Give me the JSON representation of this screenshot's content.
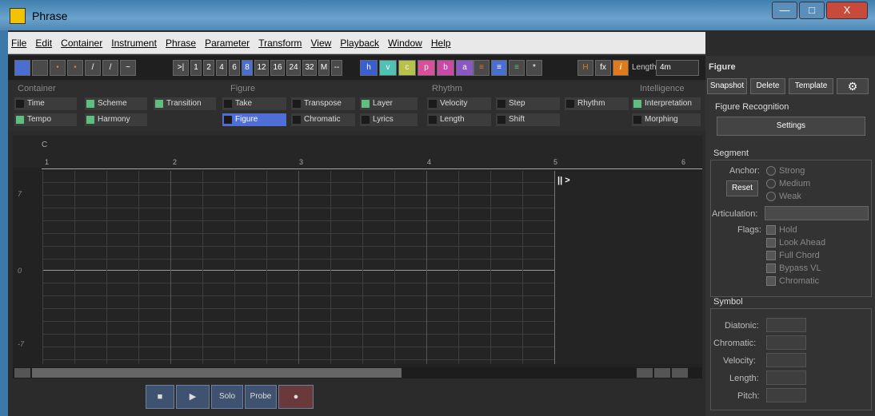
{
  "window": {
    "title": "Phrase"
  },
  "menu": [
    "File",
    "Edit",
    "Container",
    "Instrument",
    "Phrase",
    "Parameter",
    "Transform",
    "View",
    "Playback",
    "Window",
    "Help"
  ],
  "toolbar": {
    "jump": ">|",
    "resolutions": [
      "1",
      "2",
      "4",
      "6",
      "8",
      "12",
      "16",
      "24",
      "32",
      "M",
      "--"
    ],
    "letters": [
      "h",
      "v",
      "c",
      "p",
      "b",
      "a"
    ],
    "star": "*",
    "length_label": "Length:",
    "length_value": "4m"
  },
  "sections": {
    "container": {
      "title": "Container",
      "items": [
        "Time",
        "Scheme",
        "Transition",
        "Tempo",
        "Harmony"
      ]
    },
    "figure": {
      "title": "Figure",
      "items": [
        "Take",
        "Transpose",
        "Layer",
        "Figure",
        "Chromatic",
        "Lyrics"
      ]
    },
    "rhythm": {
      "title": "Rhythm",
      "items": [
        "Velocity",
        "Step",
        "Rhythm",
        "Length",
        "Shift"
      ]
    },
    "intelligence": {
      "title": "Intelligence",
      "items": [
        "Interpretation",
        "Morphing"
      ]
    }
  },
  "ruler": {
    "key": "C",
    "bars": [
      "1",
      "2",
      "3",
      "4",
      "5",
      "6"
    ]
  },
  "pitch": [
    "7",
    "0",
    "-7"
  ],
  "playhead": "|| >",
  "transport": {
    "solo": "Solo",
    "probe": "Probe"
  },
  "right": {
    "title": "Figure",
    "buttons": {
      "snapshot": "Snapshot",
      "delete": "Delete",
      "template": "Template"
    },
    "recognition": "Figure Recognition",
    "settings": "Settings",
    "segment": "Segment",
    "anchor": "Anchor:",
    "anchors": [
      "Strong",
      "Medium",
      "Weak"
    ],
    "reset": "Reset",
    "articulation": "Articulation:",
    "flags_label": "Flags:",
    "flags": [
      "Hold",
      "Look Ahead",
      "Full Chord",
      "Bypass VL",
      "Chromatic"
    ],
    "symbol": "Symbol",
    "symbols": [
      "Diatonic:",
      "Chromatic:",
      "Velocity:",
      "Length:",
      "Pitch:"
    ]
  },
  "colors": {
    "accent": "#4f6fd6",
    "green": "#5fbf7f",
    "titlebar": "#4f88b5"
  }
}
